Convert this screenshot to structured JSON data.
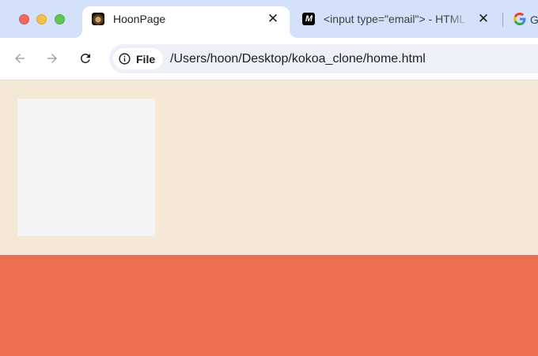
{
  "browser": {
    "tabs": [
      {
        "title": "HoonPage",
        "favicon": "hoon-avatar-icon",
        "active": true
      },
      {
        "title": "<input type=\"email\"> - HTML",
        "favicon": "mdn-icon",
        "active": false
      },
      {
        "title": "G",
        "favicon": "google-icon",
        "active": false
      }
    ],
    "close_glyph": "✕"
  },
  "toolbar": {
    "back_icon": "arrow-left-icon",
    "forward_icon": "arrow-right-icon",
    "reload_icon": "reload-icon",
    "site_info_label": "File",
    "url": "/Users/hoon/Desktop/kokoa_clone/home.html"
  },
  "page": {
    "background_color": "#f5e8d6",
    "box_color": "#f4f4f4",
    "band_color": "#ed6f52"
  }
}
